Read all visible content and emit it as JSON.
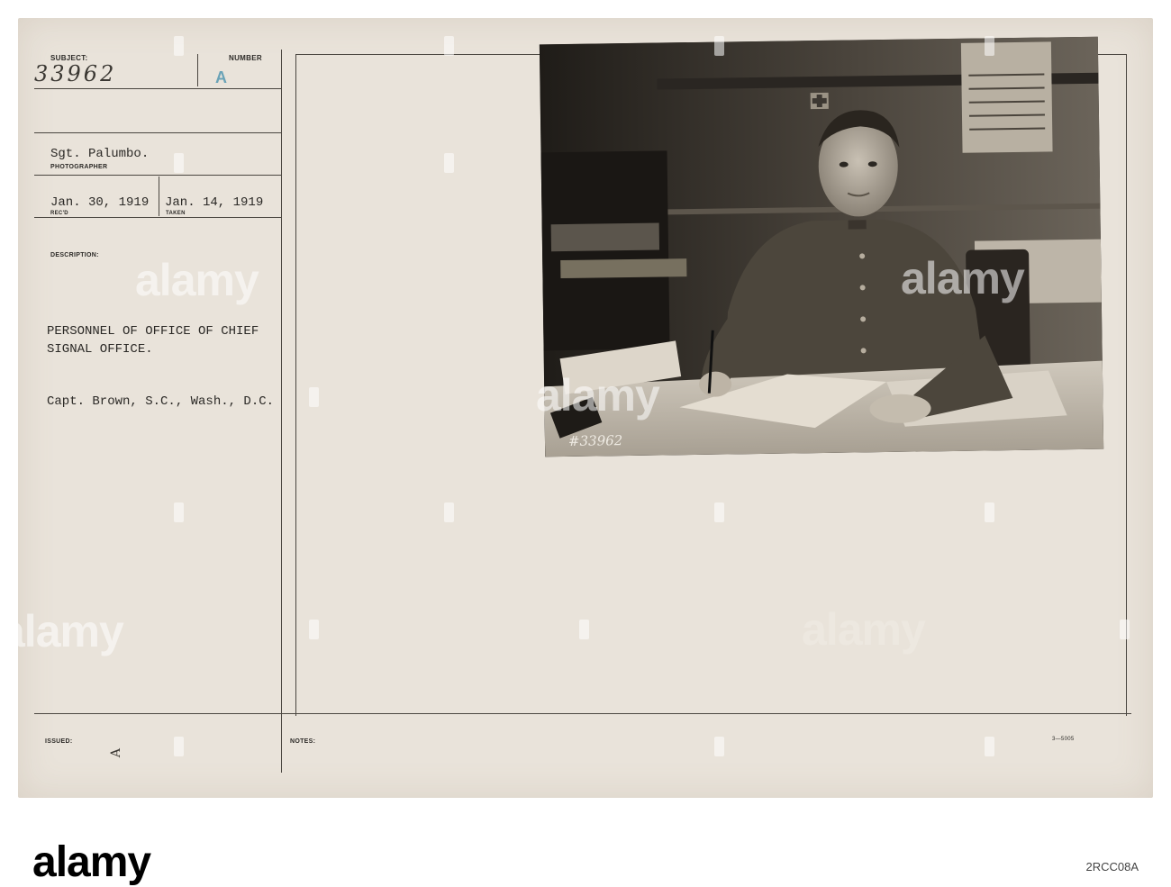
{
  "card": {
    "subject_label": "SUBJECT:",
    "subject_number": "33962",
    "number_label": "NUMBER",
    "number_value": "A",
    "photographer_name": "Sgt. Palumbo.",
    "photographer_label": "PHOTOGRAPHER",
    "recd_date": "Jan. 30, 1919",
    "recd_label": "REC'D",
    "taken_date": "Jan. 14, 1919",
    "taken_label": "TAKEN",
    "description_label": "DESCRIPTION:",
    "description_line1": "PERSONNEL OF OFFICE OF CHIEF",
    "description_line2": "SIGNAL OFFICE.",
    "description_line3": "Capt. Brown, S.C., Wash., D.C.",
    "issued_label": "ISSUED:",
    "notes_label": "NOTES:",
    "issued_mark": "A",
    "form_code": "3—5005"
  },
  "photo": {
    "negative_number": "#33962"
  },
  "watermark": {
    "text": "alamy"
  },
  "footer": {
    "logo": "alamy",
    "image_id": "2RCC08A"
  },
  "colors": {
    "card_bg": "#e9e3da",
    "ink": "#2b2926",
    "number_stamp": "#6aa3b7",
    "photo_dark": "#2f2b26"
  }
}
